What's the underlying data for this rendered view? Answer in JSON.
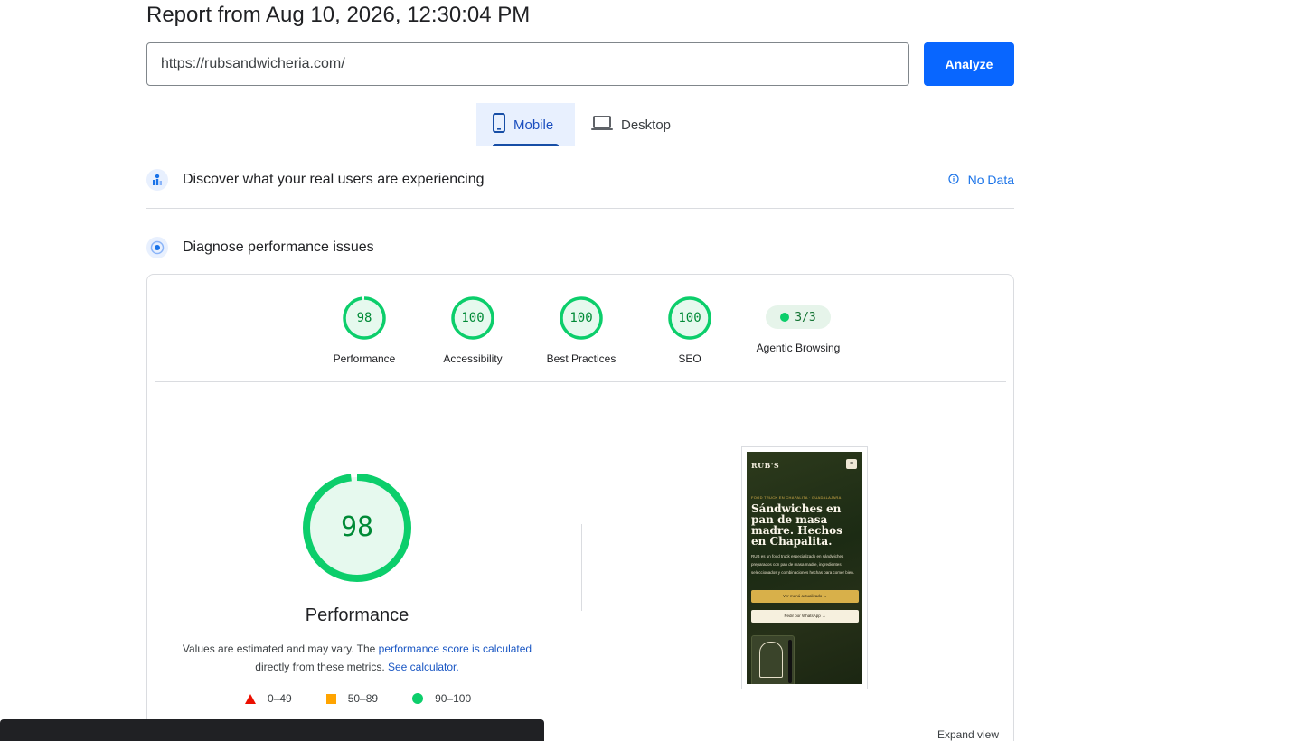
{
  "report": {
    "title": "Report from Aug 10, 2026, 12:30:04 PM"
  },
  "search": {
    "url": "https://rubsandwicheria.com/",
    "analyze_label": "Analyze"
  },
  "device_tabs": {
    "mobile": "Mobile",
    "desktop": "Desktop",
    "selected": "Mobile"
  },
  "field_data": {
    "title": "Discover what your real users are experiencing",
    "status": "No Data"
  },
  "lab_data": {
    "title": "Diagnose performance issues"
  },
  "scores": [
    {
      "label": "Performance",
      "value": "98"
    },
    {
      "label": "Accessibility",
      "value": "100"
    },
    {
      "label": "Best Practices",
      "value": "100"
    },
    {
      "label": "SEO",
      "value": "100"
    }
  ],
  "agentic": {
    "label": "Agentic Browsing",
    "value": "3/3"
  },
  "performance": {
    "score": "98",
    "label": "Performance",
    "note_prefix": "Values are estimated and may vary. The ",
    "note_link1": "performance score is calculated",
    "note_mid": " directly from these metrics. ",
    "note_link2": "See calculator."
  },
  "legend": {
    "fail": "0–49",
    "average": "50–89",
    "pass": "90–100"
  },
  "screenshot": {
    "brand": "RUB'S",
    "kicker": "FOOD TRUCK EN CHAPALITA · GUADALAJARA",
    "headline": "Sándwiches en pan de masa madre. Hechos en Chapalita.",
    "blurb": "RUB es un food truck especializado en sándwiches preparados con pan de masa madre, ingredientes seleccionados y combinaciones hechas para comer bien.",
    "cta_primary": "Ver menú actualizado →",
    "cta_secondary": "Pedir por WhatsApp →"
  },
  "expand_label": "Expand view",
  "colors": {
    "pass": "#0cce6b",
    "average": "#ffa400",
    "fail": "#eb0f00",
    "accent": "#1a73e8"
  }
}
